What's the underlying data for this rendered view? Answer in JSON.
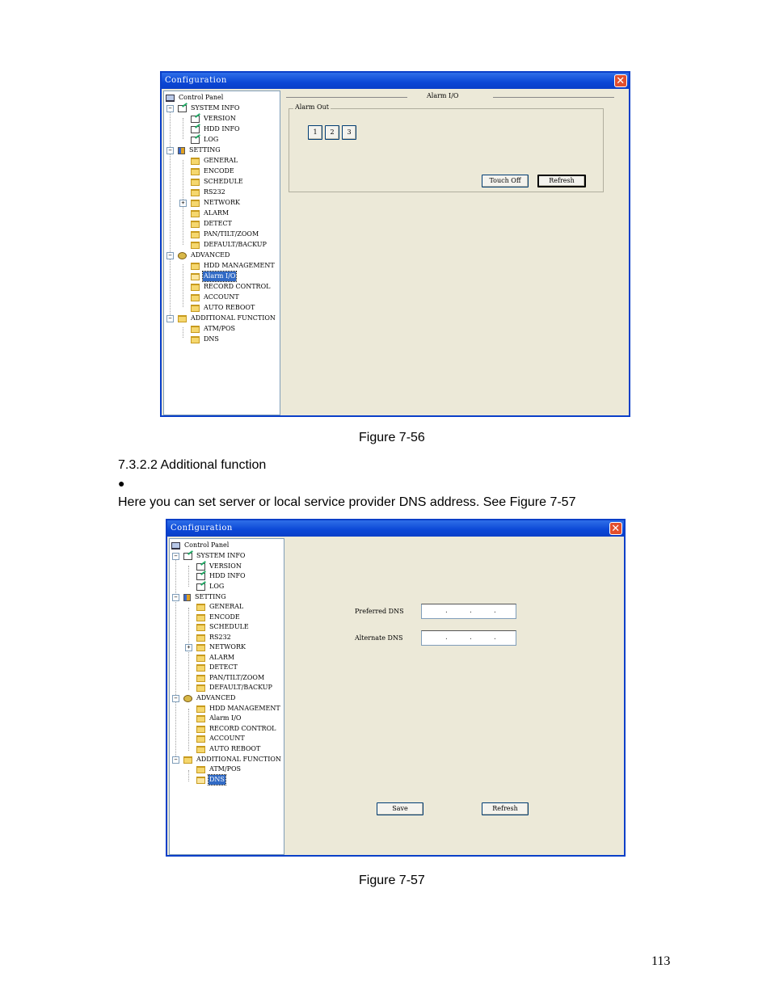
{
  "figure1": {
    "window_title": "Configuration",
    "close_glyph": "✕",
    "header": "Alarm I/O",
    "group_title": "Alarm Out",
    "channels": [
      "1",
      "2",
      "3"
    ],
    "touch_off_label": "Touch Off",
    "refresh_label": "Refresh",
    "tree": {
      "control_panel": "Control Panel",
      "system_info": "SYSTEM INFO",
      "version": "VERSION",
      "hdd_info": "HDD INFO",
      "log": "LOG",
      "setting": "SETTING",
      "general": "GENERAL",
      "encode": "ENCODE",
      "schedule": "SCHEDULE",
      "rs232": "RS232",
      "network": "NETWORK",
      "alarm": "ALARM",
      "detect": "DETECT",
      "ptz": "PAN/TILT/ZOOM",
      "default_backup": "DEFAULT/BACKUP",
      "advanced": "ADVANCED",
      "hdd_management": "HDD MANAGEMENT",
      "alarm_io": "Alarm I/O",
      "record_control": "RECORD CONTROL",
      "account": "ACCOUNT",
      "auto_reboot": "AUTO REBOOT",
      "additional_function": "ADDITIONAL FUNCTION",
      "atm_pos": "ATM/POS",
      "dns": "DNS"
    }
  },
  "caption1": "Figure 7-56",
  "section_heading": "7.3.2.2  Additional function",
  "bullet": "●",
  "paragraph": "Here you can set server or local service provider DNS address. See Figure 7-57",
  "figure2": {
    "window_title": "Configuration",
    "close_glyph": "✕",
    "preferred_dns_label": "Preferred DNS",
    "alternate_dns_label": "Alternate DNS",
    "ip_dot": ".",
    "save_label": "Save",
    "refresh_label": "Refresh"
  },
  "caption2": "Figure 7-57",
  "page_number": "113"
}
